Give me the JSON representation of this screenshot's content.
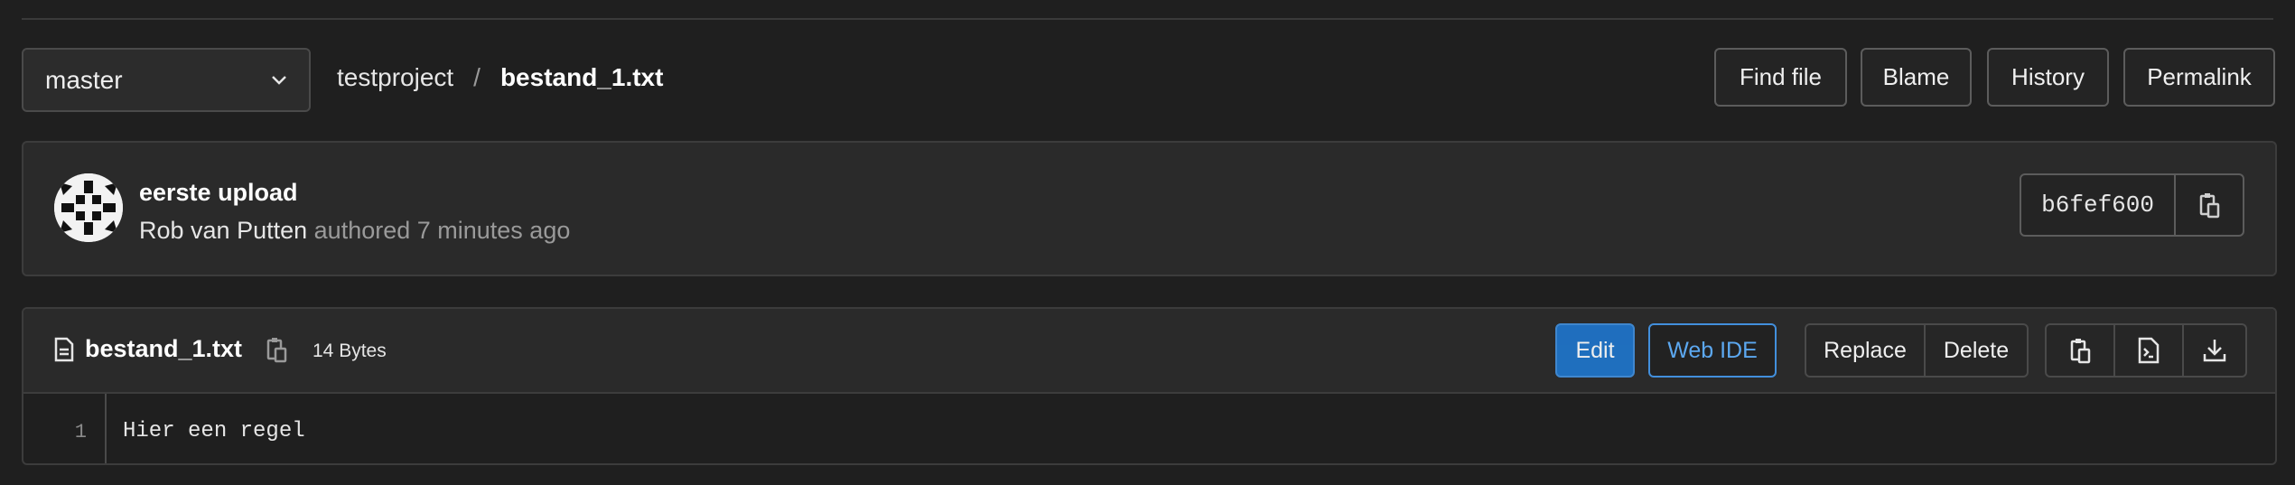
{
  "branch": {
    "name": "master"
  },
  "breadcrumb": {
    "project": "testproject",
    "separator": "/",
    "file": "bestand_1.txt"
  },
  "toolbar": {
    "find_file": "Find file",
    "blame": "Blame",
    "history": "History",
    "permalink": "Permalink"
  },
  "commit": {
    "title": "eerste upload",
    "author": "Rob van Putten",
    "meta": "authored 7 minutes ago",
    "sha": "b6fef600"
  },
  "file": {
    "name": "bestand_1.txt",
    "size": "14 Bytes",
    "actions": {
      "edit": "Edit",
      "web_ide": "Web IDE",
      "replace": "Replace",
      "delete": "Delete"
    },
    "lines": [
      {
        "number": "1",
        "text": "Hier een regel"
      }
    ]
  },
  "icons": [
    "chevron-down-icon",
    "clipboard-icon",
    "file-text-icon",
    "raw-file-icon",
    "download-icon",
    "avatar-identicon"
  ],
  "colors": {
    "accent": "#1f75cb",
    "accent_border": "#428fdc",
    "background": "#1f1f1f",
    "panel": "#2a2a2a"
  }
}
